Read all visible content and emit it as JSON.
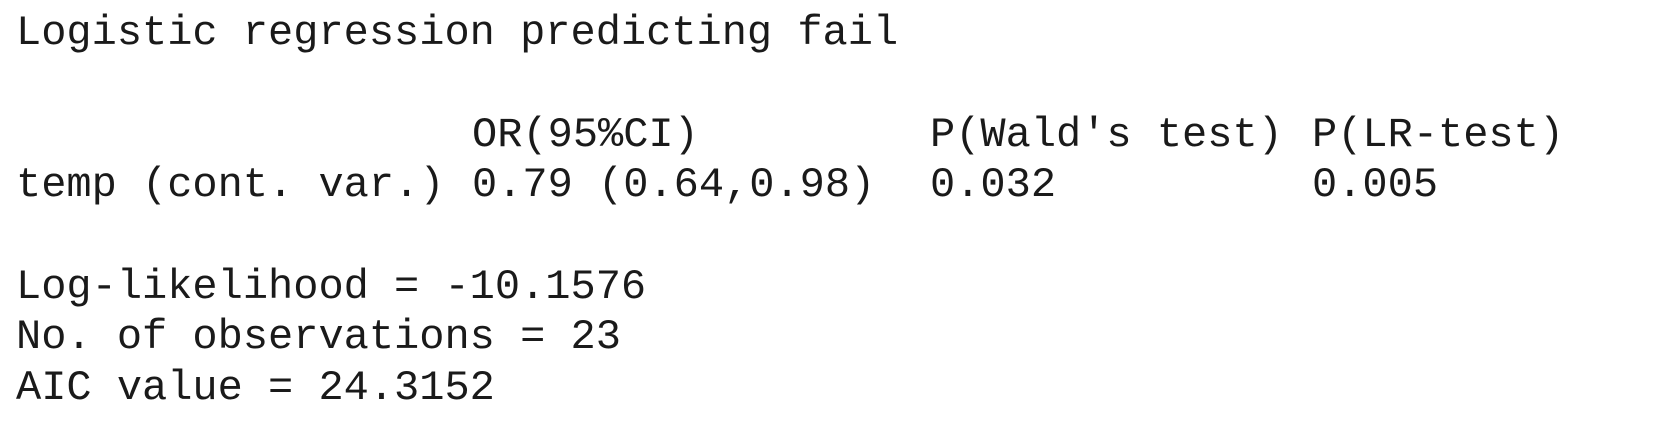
{
  "title": "Logistic regression predicting fail",
  "table": {
    "headers": {
      "or_ci": "OR(95%CI)",
      "p_wald": "P(Wald's test)",
      "p_lr": "P(LR-test)"
    },
    "rows": [
      {
        "variable": "temp (cont. var.)",
        "or_ci": "0.79 (0.64,0.98)",
        "p_wald": "0.032",
        "p_lr": "0.005"
      }
    ]
  },
  "stats": {
    "log_likelihood": "Log-likelihood = -10.1576",
    "n_obs": "No. of observations = 23",
    "aic": "AIC value = 24.3152"
  }
}
